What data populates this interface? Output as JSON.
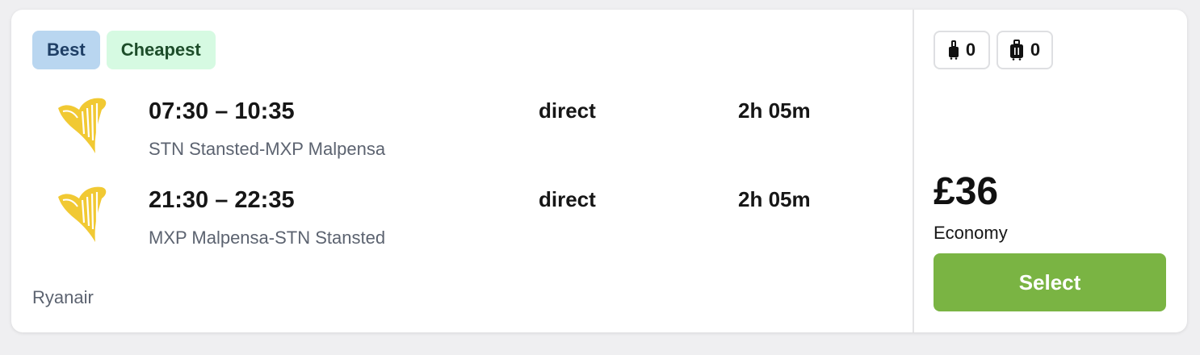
{
  "badges": {
    "best": "Best",
    "cheapest": "Cheapest"
  },
  "legs": [
    {
      "times": "07:30 – 10:35",
      "route": "STN Stansted-MXP Malpensa",
      "stops": "direct",
      "duration": "2h 05m",
      "airline_icon": "ryanair-harp-icon"
    },
    {
      "times": "21:30 – 22:35",
      "route": "MXP Malpensa-STN Stansted",
      "stops": "direct",
      "duration": "2h 05m",
      "airline_icon": "ryanair-harp-icon"
    }
  ],
  "airline": "Ryanair",
  "bags": {
    "cabin_bag_count": "0",
    "checked_bag_count": "0"
  },
  "price": {
    "amount": "£36",
    "cabin_class": "Economy"
  },
  "select_label": "Select",
  "colors": {
    "accent_green": "#7ab443",
    "best_badge": "#b9d6f0",
    "cheapest_badge": "#d6fae2",
    "logo_yellow": "#f1c933"
  }
}
